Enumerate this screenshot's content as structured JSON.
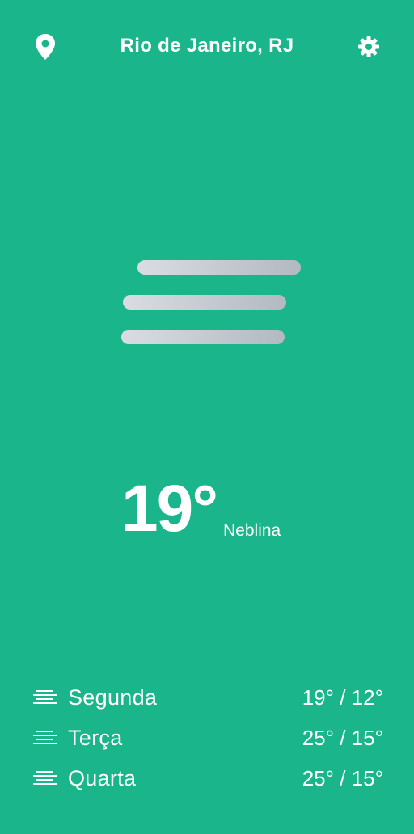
{
  "header": {
    "city": "Rio de Janeiro, RJ",
    "left_icon": "location-pin-icon",
    "right_icon": "gear-icon"
  },
  "current": {
    "temperature": "19°",
    "condition": "Neblina",
    "icon": "fog-icon"
  },
  "forecast": [
    {
      "day": "Segunda",
      "temps": "19° / 12°",
      "icon": "fog-icon"
    },
    {
      "day": "Terça",
      "temps": "25° / 15°",
      "icon": "fog-icon"
    },
    {
      "day": "Quarta",
      "temps": "25° / 15°",
      "icon": "fog-icon"
    }
  ],
  "colors": {
    "background": "#1ab58a",
    "text": "#ffffff",
    "fog_bar_light": "#d9dde3",
    "fog_bar_dark": "#aeb4bd"
  }
}
